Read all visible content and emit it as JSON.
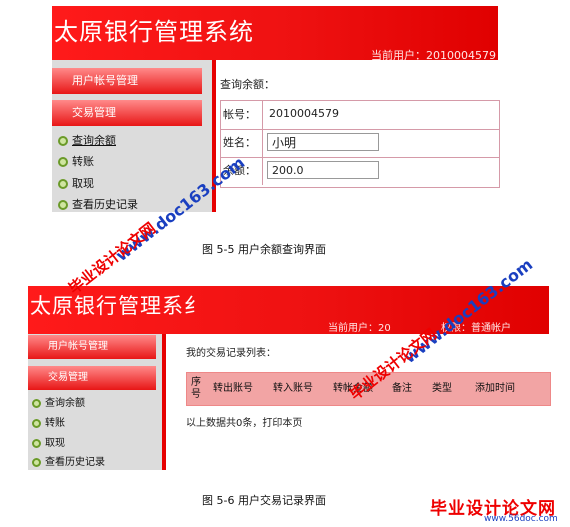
{
  "screen1": {
    "app_title": "太原银行管理系统",
    "current_user": "当前用户：2010004579",
    "menu_account": "用户帐号管理",
    "menu_transaction": "交易管理",
    "sub_items": [
      "查询余额",
      "转账",
      "取现",
      "查看历史记录"
    ],
    "query_label": "查询余额：",
    "form": {
      "account_label": "帐号：",
      "account_value": "2010004579",
      "name_label": "姓名：",
      "name_value": "小明",
      "balance_label": "余额：",
      "balance_value": "200.0"
    },
    "caption": "图 5-5  用户余额查询界面"
  },
  "screen2": {
    "app_title": "太原银行管理系纟",
    "current_user": "当前用户：20",
    "role": "权限：普通帐户",
    "menu_account": "用户帐号管理",
    "menu_transaction": "交易管理",
    "sub_items": [
      "查询余额",
      "转账",
      "取现",
      "查看历史记录"
    ],
    "list_label": "我的交易记录列表：",
    "columns": [
      "序号",
      "转出账号",
      "转入账号",
      "转帐金额",
      "备注",
      "类型",
      "添加时间"
    ],
    "footer": "以上数据共0条，打印本页",
    "caption": "图 5-6 用户交易记录界面"
  },
  "watermarks": {
    "site_cn": "毕业设计论文网",
    "site_url": "www.doc163.com",
    "logo_cn": "毕业设计论文网",
    "logo_url": "www.56doc.com"
  },
  "colors": {
    "banner_red": "#ee1111",
    "menu_pink": "#ff8a8a",
    "table_header": "#f2a4a4",
    "sidebar_gray": "#dcdcdc"
  }
}
